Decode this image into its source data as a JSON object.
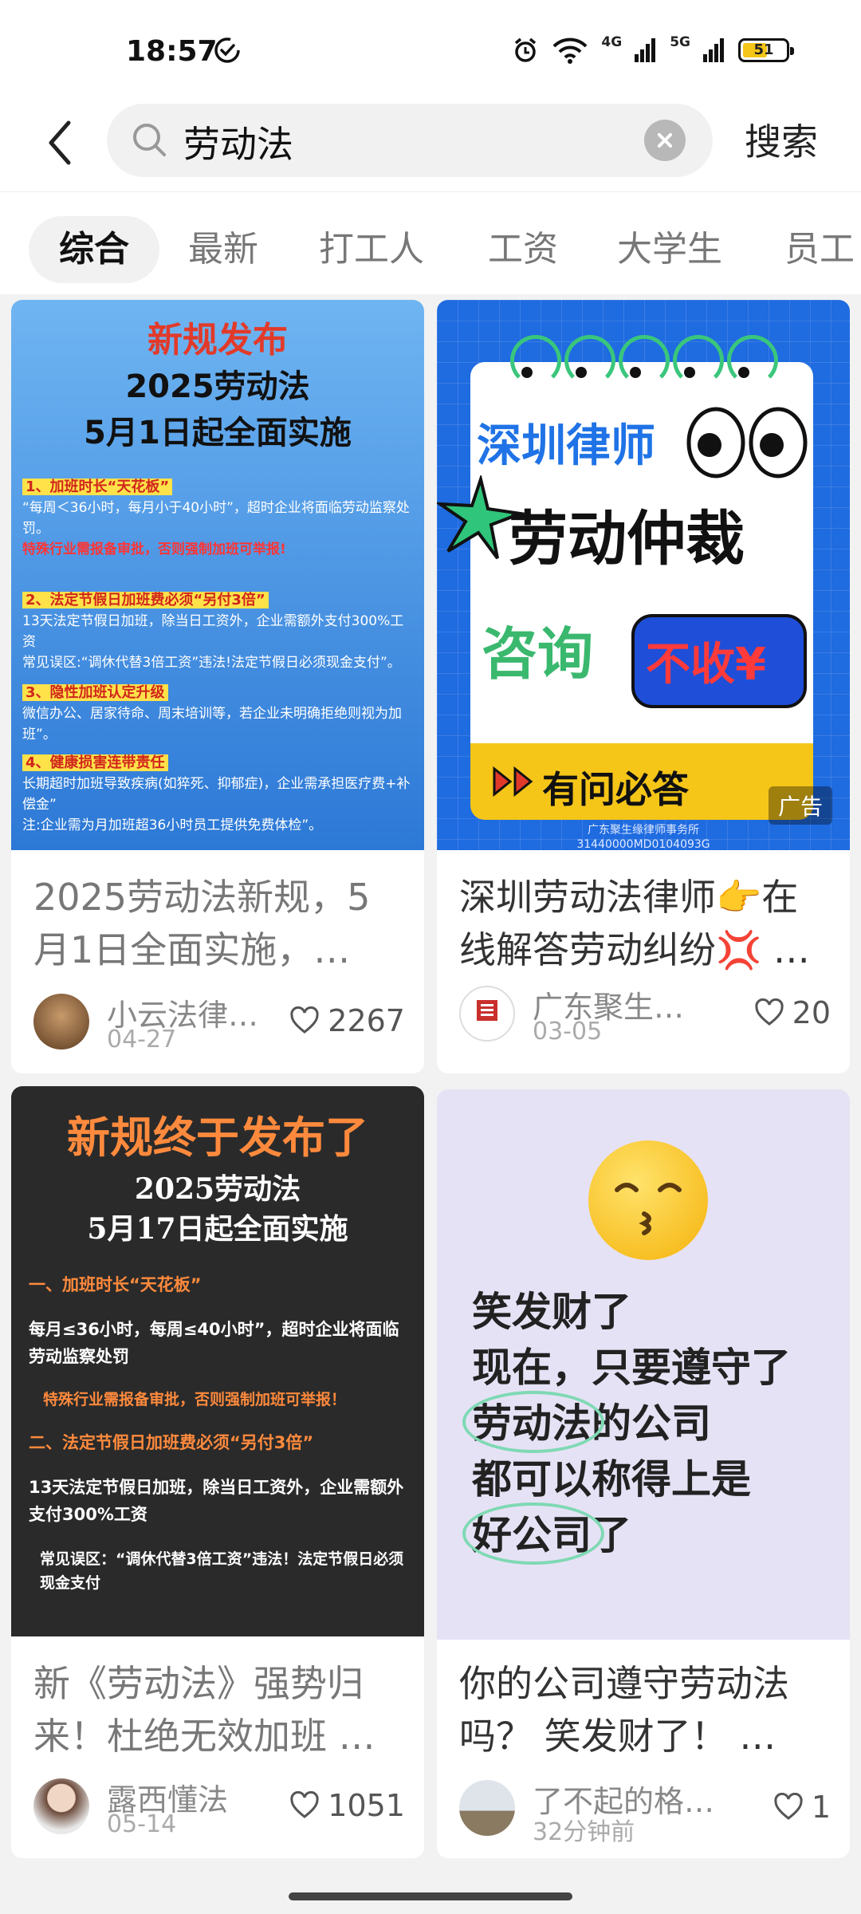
{
  "status": {
    "time": "18:57",
    "net1": "4G",
    "net2": "5G",
    "battery": "51"
  },
  "search": {
    "query": "劳动法",
    "button": "搜索"
  },
  "tabs": [
    {
      "label": "综合",
      "active": true
    },
    {
      "label": "最新"
    },
    {
      "label": "打工人"
    },
    {
      "label": "工资"
    },
    {
      "label": "大学生"
    },
    {
      "label": "员工"
    }
  ],
  "cards": [
    {
      "title": "2025劳动法新规，5月1日全面实施，…",
      "author": "小云法律…",
      "date": "04-27",
      "likes": "2267",
      "cover": {
        "h1": "新规发布",
        "h2": "2025劳动法",
        "h3": "5月1日起全面实施",
        "s1_title": "1、加班时长“天花板”",
        "s1_line1": "“每周＜36小时，每月小于40小时”，超时企业将面临劳动监察处罚。",
        "s1_line2": "特殊行业需报备审批，否则强制加班可举报!",
        "s2_title": "2、法定节假日加班费必须“另付3倍”",
        "s2_line1": "13天法定节假日加班，除当日工资外，企业需额外支付300%工资",
        "s2_line2": "常见误区:“调休代替3倍工资”违法!法定节假日必须现金支付”。",
        "s3_title": "3、隐性加班认定升级",
        "s3_line1": "微信办公、居家待命、周末培训等，若企业未明确拒绝则视为加班”。",
        "s4_title": "4、健康损害连带责任",
        "s4_line1": "长期超时加班导致疾病(如猝死、抑郁症)，企业需承担医疗费+补偿金”",
        "s4_line2": "注:企业需为月加班超36小时员工提供免费体检”。"
      }
    },
    {
      "title": "深圳劳动法律师👉在线解答劳动纠纷💢 …",
      "author": "广东聚生…",
      "date": "03-05",
      "likes": "20",
      "ad": "广告",
      "cover": {
        "t1": "深圳律师",
        "t2": "劳动仲裁",
        "t3": "咨询",
        "bubble": "不收¥",
        "band": "有问必答",
        "foot1": "广东聚生缘律师事务所",
        "foot2": "31440000MD0104093G"
      }
    },
    {
      "title": "新《劳动法》强势归来！杜绝无效加班 …",
      "author": "露西懂法",
      "date": "05-14",
      "likes": "1051",
      "cover": {
        "h1": "新规终于发布了",
        "h2": "2025劳动法",
        "h3": "5月17日起全面实施",
        "p1": "一、加班时长“天花板”",
        "p2": "每月≤36小时，每周≤40小时”，超时企业将面临劳动监察处罚",
        "p3": "特殊行业需报备审批，否则强制加班可举报！",
        "p4": "二、法定节假日加班费必须“另付3倍”",
        "p5": "13天法定节假日加班，除当日工资外，企业需额外支付300%工资",
        "p6": "常见误区：“调休代替3倍工资”违法！法定节假日必须现金支付"
      }
    },
    {
      "title": "你的公司遵守劳动法吗？ 笑发财了！ …",
      "author": "了不起的格…",
      "date": "32分钟前",
      "likes": "1",
      "cover": {
        "line1": "笑发财了",
        "line2": "现在，只要遵守了",
        "line3": "劳动法的公司",
        "line4": "都可以称得上是",
        "line5": "好公司了"
      }
    }
  ]
}
